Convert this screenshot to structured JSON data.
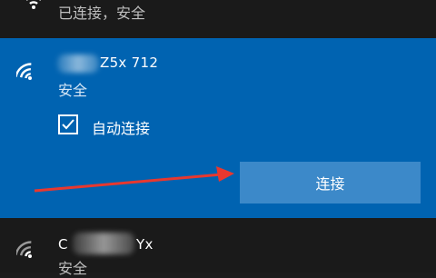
{
  "networks": [
    {
      "ssid": "",
      "status": "已连接，安全"
    },
    {
      "ssid": "Z5x 712",
      "status": "安全",
      "auto_connect_label": "自动连接",
      "auto_connect_checked": true,
      "connect_label": "连接"
    },
    {
      "ssid_prefix": "C",
      "ssid_suffix": "Yx",
      "status": "安全"
    }
  ],
  "colors": {
    "selected_bg": "#0063b1",
    "button_bg": "#3c89c9",
    "arrow": "#e8382f"
  },
  "icons": {
    "wifi": "wifi-signal-icon",
    "checkbox": "checkmark-icon"
  }
}
